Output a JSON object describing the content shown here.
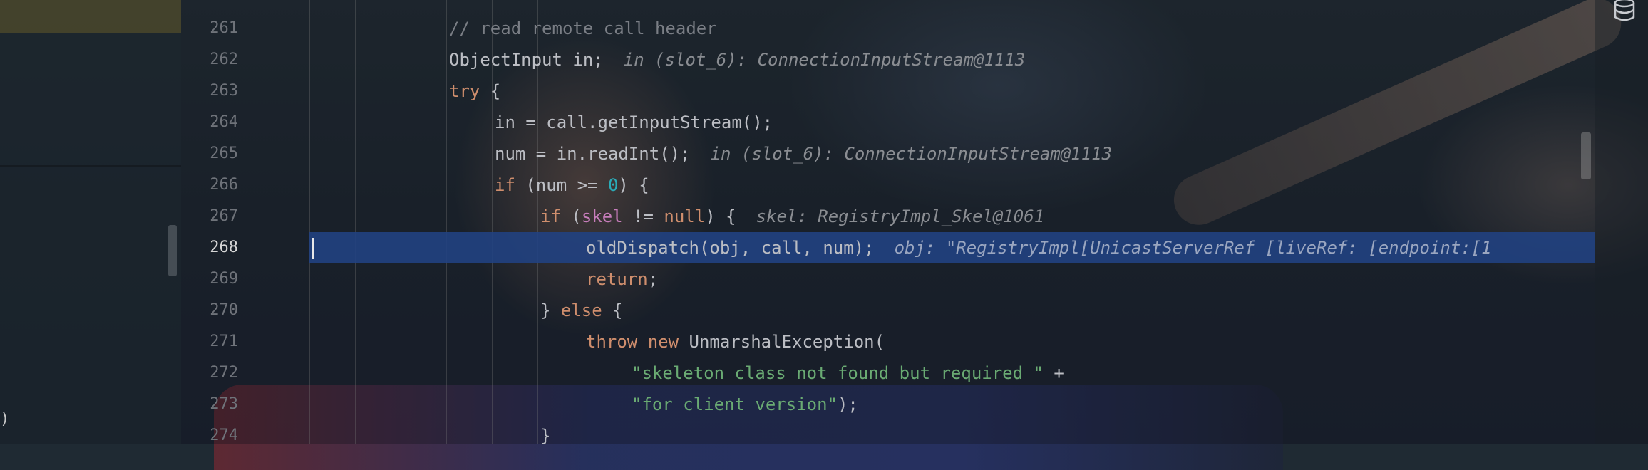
{
  "gutter": {
    "lines": [
      "261",
      "262",
      "263",
      "264",
      "265",
      "266",
      "267",
      "268",
      "269",
      "270",
      "271",
      "272",
      "273",
      "274"
    ],
    "current_line": "268"
  },
  "code": {
    "l261": {
      "comment": "// read remote call header"
    },
    "l262": {
      "text": "ObjectInput in;",
      "hint": "in (slot_6): ConnectionInputStream@1113"
    },
    "l263": {
      "kw": "try",
      "rest": " {"
    },
    "l264": {
      "text": "in = call.getInputStream();"
    },
    "l265": {
      "text": "num = in.readInt();",
      "hint": "in (slot_6): ConnectionInputStream@1113"
    },
    "l266": {
      "kw": "if",
      "a": " (num >= ",
      "num": "0",
      "b": ") {"
    },
    "l267": {
      "kw": "if",
      "a": " (",
      "field": "skel",
      "b": " != ",
      "kw2": "null",
      "c": ") {",
      "hint": "skel: RegistryImpl_Skel@1061"
    },
    "l268": {
      "text": "oldDispatch(obj, call, num);",
      "hint": "obj: \"RegistryImpl[UnicastServerRef [liveRef: [endpoint:[1"
    },
    "l269": {
      "kw": "return",
      "rest": ";"
    },
    "l270": {
      "a": "} ",
      "kw": "else",
      "b": " {"
    },
    "l271": {
      "kw": "throw",
      "kw2": "new",
      "rest": " UnmarshalException("
    },
    "l272": {
      "str": "\"skeleton class not found but required \"",
      "rest": " +"
    },
    "l273": {
      "str": "\"for client version\"",
      "rest": ");"
    },
    "l274": {
      "text": "}"
    }
  },
  "left_panel": {
    "partial_char": ")"
  },
  "icons": {
    "right_top": "database-icon"
  }
}
